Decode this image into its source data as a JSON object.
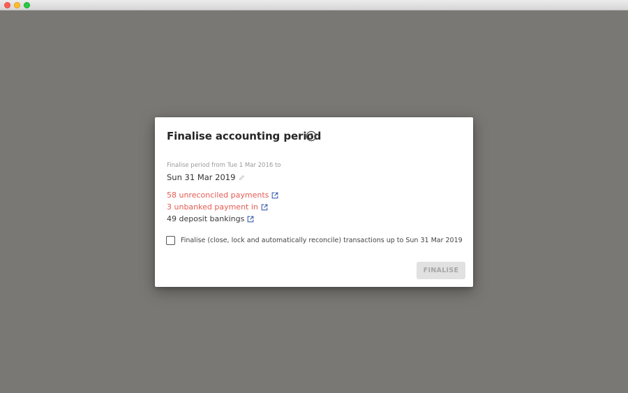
{
  "window": {
    "traffic_lights": [
      "close",
      "minimize",
      "maximize"
    ]
  },
  "dialog": {
    "title": "Finalise accounting period",
    "help_icon": "question-circle-icon",
    "period_label": "Finalise period from Tue 1 Mar 2016 to",
    "end_date": "Sun 31 Mar 2019",
    "edit_icon": "pencil-icon",
    "stats": [
      {
        "text": "58 unreconciled payments",
        "color": "#e45b52",
        "icon": "external-link-icon"
      },
      {
        "text": "3 unbanked payment in",
        "color": "#e45b52",
        "icon": "external-link-icon"
      },
      {
        "text": "49 deposit bankings",
        "color": "#3a3a3a",
        "icon": "external-link-icon"
      }
    ],
    "checkbox_label": "Finalise (close, lock and automatically reconcile) transactions up to Sun 31 Mar 2019",
    "checkbox_checked": false,
    "finalise_button": "FINALISE",
    "finalise_button_enabled": false
  },
  "colors": {
    "backdrop": "#7a7874",
    "warning_text": "#e45b52",
    "link_icon": "#3b5fb0",
    "button_disabled_bg": "#e1e1e1",
    "button_disabled_text": "#a6a6a6"
  }
}
